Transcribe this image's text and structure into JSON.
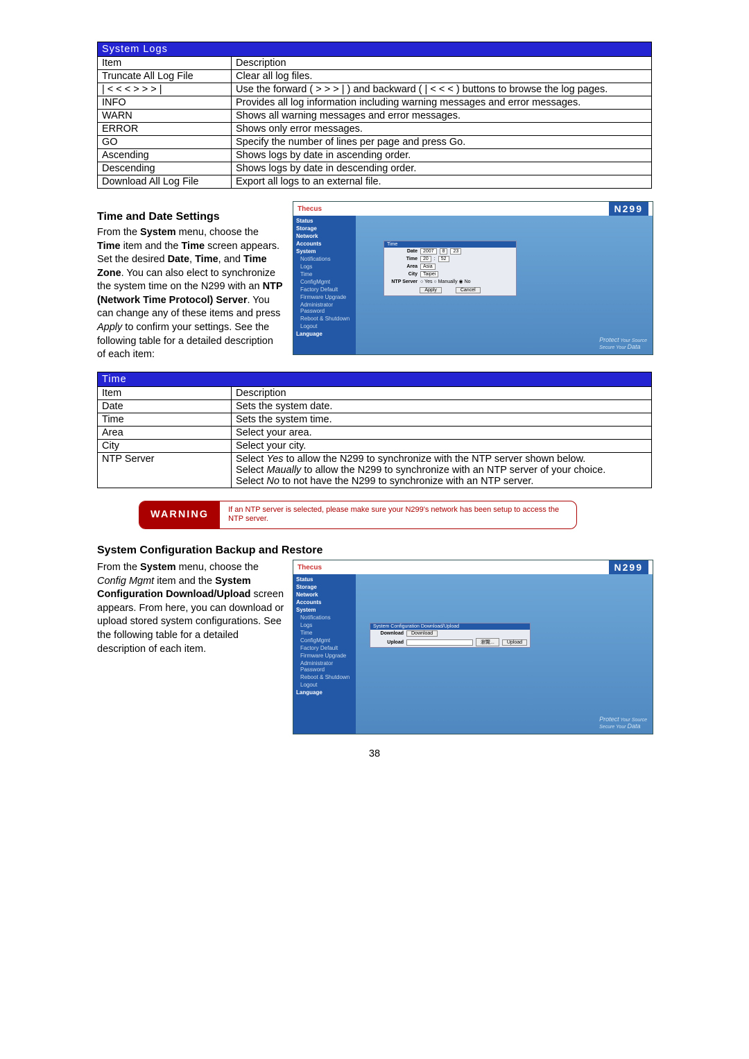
{
  "page_number": "38",
  "tables": {
    "syslogs": {
      "title": "System Logs",
      "head_item": "Item",
      "head_desc": "Description",
      "rows": [
        {
          "item": "Truncate All Log File",
          "desc": "Clear all log files."
        },
        {
          "item": "| < <   <   >   > > |",
          "desc": "Use the forward ( >  > > | ) and backward ( | < <  < )  buttons to browse the log pages."
        },
        {
          "item": "INFO",
          "desc": "Provides all log information including warning messages and error messages."
        },
        {
          "item": "WARN",
          "desc": "Shows all warning messages and error messages."
        },
        {
          "item": "ERROR",
          "desc": "Shows only error messages."
        },
        {
          "item": "GO",
          "desc": "Specify the number of lines per page and press Go."
        },
        {
          "item": "Ascending",
          "desc": "Shows logs by date in ascending order."
        },
        {
          "item": "Descending",
          "desc": "Shows logs by date in descending order."
        },
        {
          "item": "Download All Log File",
          "desc": "Export all logs to an external file."
        }
      ]
    },
    "time": {
      "title": "Time",
      "head_item": "Item",
      "head_desc": "Description",
      "rows": [
        {
          "item": "Date",
          "desc": "Sets the system date."
        },
        {
          "item": "Time",
          "desc": "Sets the system time."
        },
        {
          "item": "Area",
          "desc": "Select your area."
        },
        {
          "item": "City",
          "desc": "Select your city."
        }
      ],
      "ntp_item": "NTP Server",
      "ntp_l1a": "Select ",
      "ntp_l1b": "Yes",
      "ntp_l1c": " to allow the N299 to synchronize with the NTP server shown below.",
      "ntp_l2a": "Select ",
      "ntp_l2b": "Maually",
      "ntp_l2c": " to allow the N299 to synchronize with an NTP server of your choice.",
      "ntp_l3a": "Select ",
      "ntp_l3b": "No",
      "ntp_l3c": " to not have the N299 to synchronize with an NTP server."
    }
  },
  "sections": {
    "time_heading": "Time and Date Settings",
    "time_p1a": "From the ",
    "time_p1b": "System",
    "time_p1c": " menu, choose the ",
    "time_p1d": "Time",
    "time_p1e": " item and the ",
    "time_p1f": "Time",
    "time_p1g": " screen appears. Set the desired ",
    "time_p1h": "Date",
    "time_p1i": ", ",
    "time_p1j": "Time",
    "time_p1k": ", and ",
    "time_p1l": "Time Zone",
    "time_p1m": ". You can also elect to synchronize the system time on the N299 with an ",
    "time_p1n": "NTP (Network Time Protocol) Server",
    "time_p1o": ". You can change any of these items and press ",
    "time_p1p": "Apply",
    "time_p1q": " to confirm your settings. See the following table for a detailed description of each item:",
    "cfg_heading": "System Configuration Backup and Restore",
    "cfg_p1a": "From the ",
    "cfg_p1b": "System",
    "cfg_p1c": " menu, choose the ",
    "cfg_p1d": "Config Mgmt",
    "cfg_p1e": " item and the ",
    "cfg_p1f": "System Configuration Download/Upload",
    "cfg_p1g": " screen appears. From here, you can download or upload stored system configurations. See the following table for a detailed description of each item."
  },
  "warning": {
    "label": "WARNING",
    "text": "If an NTP server is selected, please make sure your N299's network has been setup to access the NTP server."
  },
  "shot_common": {
    "logo": "Thecus",
    "model": "N299",
    "protect1": "Protect",
    "protect2": " Your Source",
    "protect3": "Secure Your ",
    "protect4": "Data",
    "side": {
      "status": "Status",
      "storage": "Storage",
      "network": "Network",
      "accounts": "Accounts",
      "system": "System",
      "notifications": "Notifications",
      "logs": "Logs",
      "time": "Time",
      "configmgmt": "ConfigMgmt",
      "factory": "Factory Default",
      "firmware": "Firmware Upgrade",
      "adminpw": "Administrator Password",
      "reboot": "Reboot & Shutdown",
      "logout": "Logout",
      "language": "Language"
    }
  },
  "shot_time": {
    "panel_title": "Time",
    "labels": {
      "date": "Date",
      "time": "Time",
      "area": "Area",
      "city": "City",
      "ntp": "NTP Server"
    },
    "vals": {
      "year": "2007",
      "mon": "8",
      "day": "23",
      "h": "20",
      "m": "52",
      "area": "Asia",
      "city": "Taipei"
    },
    "ntp_opts": {
      "yes": "Yes",
      "manual": "Manually",
      "no": "No"
    },
    "btns": {
      "apply": "Apply",
      "cancel": "Cancel"
    }
  },
  "shot_cfg": {
    "panel_title": "System Configuration Download/Upload",
    "labels": {
      "download": "Download",
      "upload": "Upload"
    },
    "btns": {
      "download": "Download",
      "browse": "瀏覽...",
      "upload": "Upload"
    }
  }
}
